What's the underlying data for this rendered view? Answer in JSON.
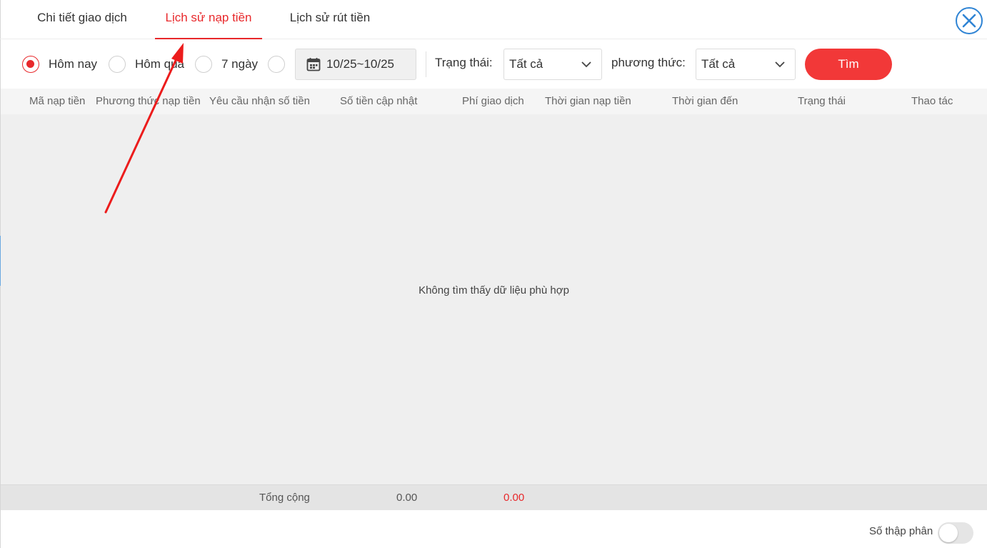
{
  "tabs": [
    {
      "label": "Chi tiết giao dịch"
    },
    {
      "label": "Lịch sử nạp tiền"
    },
    {
      "label": "Lịch sử rút tiền"
    }
  ],
  "active_tab": "Lịch sử nạp tiền",
  "filters": {
    "radios": [
      {
        "label": "Hôm nay",
        "checked": true
      },
      {
        "label": "Hôm qua",
        "checked": false
      },
      {
        "label": "7 ngày",
        "checked": false
      },
      {
        "label": "",
        "checked": false
      }
    ],
    "date_range": "10/25~10/25",
    "status_label": "Trạng thái",
    "status_value": "Tất cả",
    "method_label": "phương thức",
    "method_value": "Tất cả",
    "search_label": "Tìm"
  },
  "table": {
    "columns": [
      "Mã nạp tiền",
      "Phương thức nạp tiền",
      "Yêu cầu nhận số tiền",
      "Số tiền cập nhật",
      "Phí giao dịch",
      "Thời gian nạp tiền",
      "Thời gian đến",
      "Trạng thái",
      "Thao tác"
    ],
    "empty_message": "Không tìm thấy dữ liệu phù hợp",
    "footer": {
      "label": "Tổng cộng",
      "updated_total": "0.00",
      "fee_total": "0.00"
    }
  },
  "decimal_label": "Số thập phân",
  "decimal_enabled": false,
  "colors": {
    "accent": "#e8282b",
    "button": "#f23838",
    "close": "#2f84d4"
  },
  "icons": {
    "close": "close-icon",
    "calendar": "calendar-icon",
    "dropdown": "chevron-down-icon"
  }
}
